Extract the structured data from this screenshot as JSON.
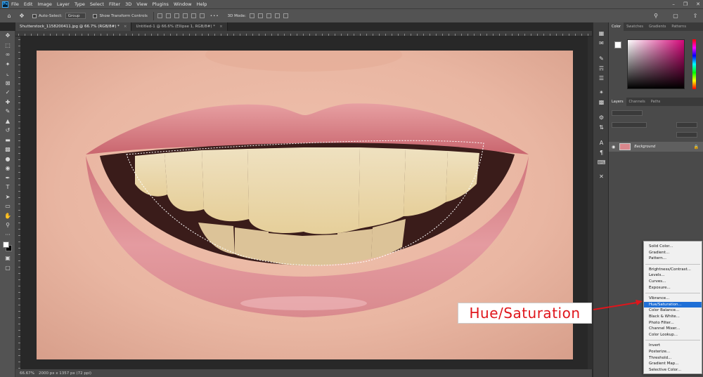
{
  "app": {
    "logo_text": "Ps"
  },
  "menubar": {
    "items": [
      "File",
      "Edit",
      "Image",
      "Layer",
      "Type",
      "Select",
      "Filter",
      "3D",
      "View",
      "Plugins",
      "Window",
      "Help"
    ]
  },
  "optionsbar": {
    "auto_select_label": "Auto-Select:",
    "auto_select_value": "Group",
    "transform_label": "Show Transform Controls",
    "mode_3d_label": "3D Mode:"
  },
  "tabs": [
    {
      "label": "Shutterstock_1158200411.jpg @ 66.7% (RGB/8#) *",
      "active": true
    },
    {
      "label": "Untitled-1 @ 66.6% (Ellipse 1, RGB/8#) *",
      "active": false
    }
  ],
  "statusbar": {
    "zoom": "66.67%",
    "doc_info": "2000 px x 1357 px (72 ppi)"
  },
  "panels": {
    "color_tabs": [
      "Color",
      "Swatches",
      "Gradients",
      "Patterns"
    ],
    "layers_tabs": [
      "Layers",
      "Channels",
      "Paths"
    ],
    "layer_name": "Background",
    "colors": {
      "fg": "#ffffff",
      "bg": "#000000",
      "field_hue": "#d5087a"
    }
  },
  "adjustment_menu": {
    "groups": [
      [
        "Solid Color...",
        "Gradient...",
        "Pattern..."
      ],
      [
        "Brightness/Contrast...",
        "Levels...",
        "Curves...",
        "Exposure..."
      ],
      [
        "Vibrance...",
        "Hue/Saturation...",
        "Color Balance...",
        "Black & White...",
        "Photo Filter...",
        "Channel Mixer...",
        "Color Lookup..."
      ],
      [
        "Invert",
        "Posterize...",
        "Threshold...",
        "Gradient Map...",
        "Selective Color..."
      ]
    ],
    "highlighted": "Hue/Saturation..."
  },
  "callout": {
    "text": "Hue/Saturation",
    "color": "#e0151b"
  }
}
